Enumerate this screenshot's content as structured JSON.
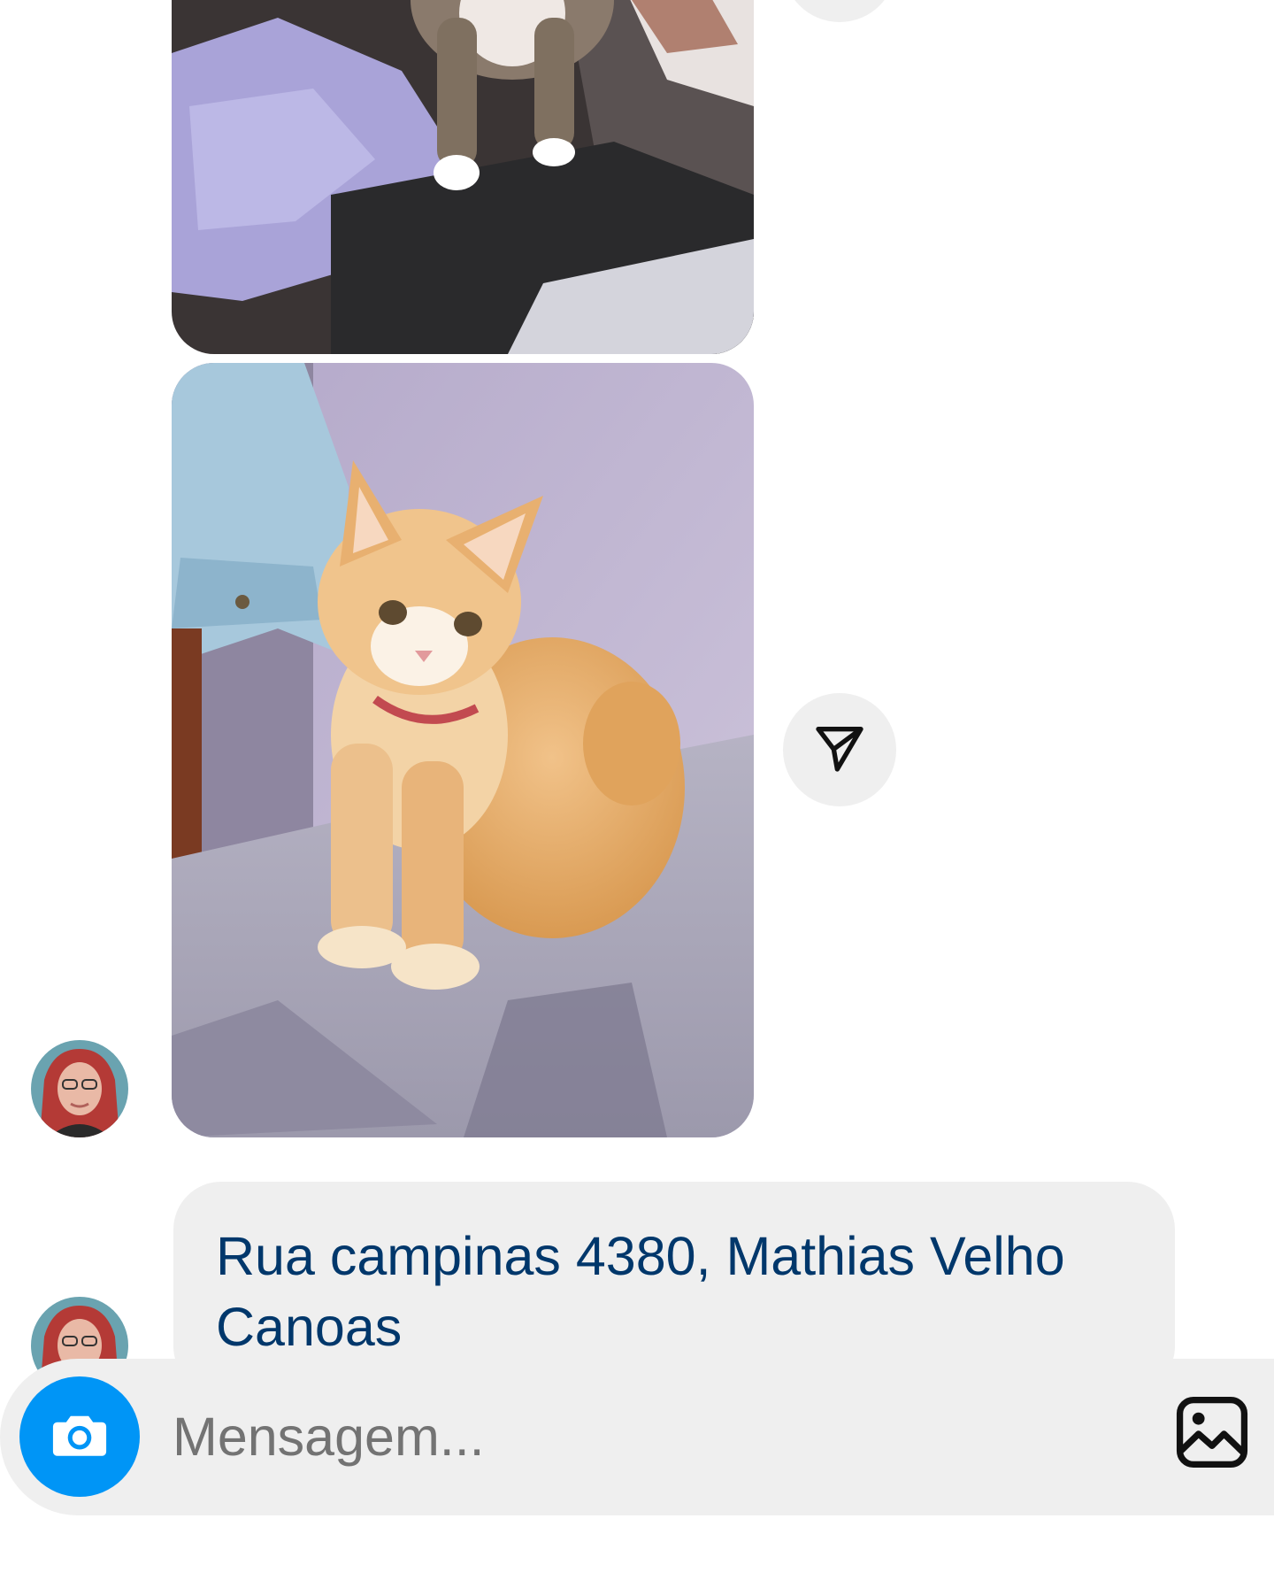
{
  "thread": {
    "messages": [
      {
        "type": "image",
        "alt": "Tabby cat with white paws standing on dark fabric"
      },
      {
        "type": "image",
        "alt": "Orange cat with red collar sitting on grey fabric"
      },
      {
        "type": "text",
        "text": "Rua campinas 4380, Mathias Velho Canoas"
      }
    ]
  },
  "icons": {
    "share": "paper-plane-icon",
    "camera": "camera-icon",
    "gallery": "image-gallery-icon"
  },
  "composer": {
    "placeholder": "Mensagem..."
  },
  "colors": {
    "bubble_bg": "#efefef",
    "link_text": "#00376b",
    "camera_button": "#0095f6",
    "placeholder": "#737373"
  }
}
